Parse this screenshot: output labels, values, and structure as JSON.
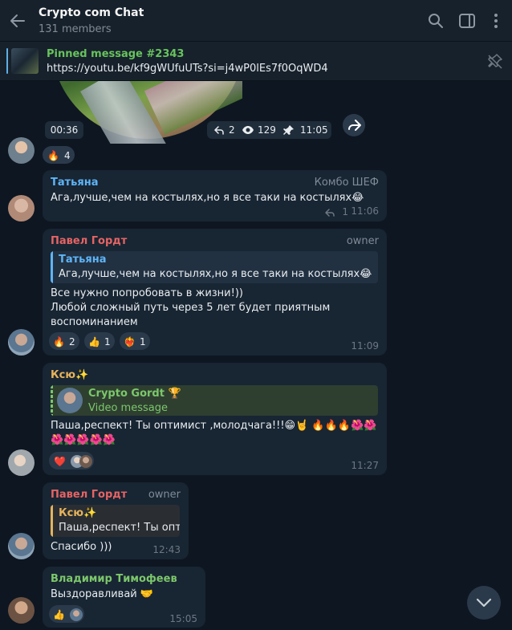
{
  "header": {
    "title": "Crypto com Chat",
    "members": "131 members"
  },
  "pinned": {
    "title": "Pinned message #2343",
    "text": "https://youtu.be/kf9gWUfuUTs?si=j4wP0lEs7f0OqWD4"
  },
  "video_message": {
    "duration": "00:36",
    "replies": "2",
    "views": "129",
    "time": "11:05",
    "reaction_emoji": "🔥",
    "reaction_count": "4"
  },
  "messages": [
    {
      "sender": "Татьяна",
      "role": "Комбо ШЕФ",
      "text": "Ага,лучше,чем на костылях,но я все таки на костылях😂",
      "replies": "1",
      "time": "11:06",
      "name_color": "#5eb5f7"
    },
    {
      "sender": "Павел Гордт",
      "role": "owner",
      "quote_name": "Татьяна",
      "quote_text": "Ага,лучше,чем на костылях,но я все таки на костылях😂",
      "lines": [
        "Все нужно попробовать в жизни!))",
        "Любой сложный путь через 5 лет будет приятным",
        "воспоминанием"
      ],
      "reactions": [
        {
          "emoji": "🔥",
          "count": "2"
        },
        {
          "emoji": "👍",
          "count": "1"
        },
        {
          "emoji": "❤️‍🔥",
          "count": "1"
        }
      ],
      "time": "11:09",
      "name_color": "#e56464"
    },
    {
      "sender": "Ксю✨",
      "quote_name": "Crypto Gordt 🏆",
      "quote_text": "Video message",
      "lines": [
        "Паша,респект! Ты оптимист ,молодчага!!!😁🤘 🔥🔥🔥🌺🌺",
        "🌺🌺🌺🌺🌺"
      ],
      "reaction_emoji": "❤️",
      "time": "11:27",
      "name_color": "#e5b35c"
    },
    {
      "sender": "Павел Гордт",
      "role": "owner",
      "quote_name": "Ксю✨",
      "quote_text": "Паша,респект! Ты опт...",
      "text": "Спасибо )))",
      "time": "12:43",
      "name_color": "#e56464"
    },
    {
      "sender": "Владимир Тимофеев",
      "text": "Выздоравливай 🤝",
      "reaction_emoji": "👍",
      "time": "15:05",
      "name_color": "#7cc76b"
    }
  ]
}
